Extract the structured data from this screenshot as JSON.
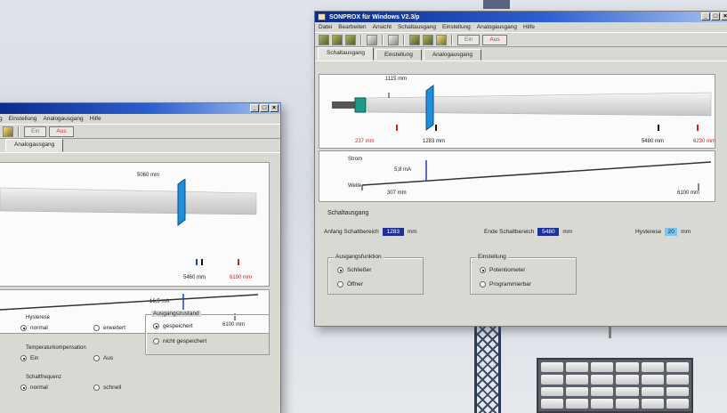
{
  "front_window": {
    "title": "SONPROX für Windows V2.3/p",
    "window_buttons": [
      "_",
      "□",
      "×"
    ],
    "menu": [
      "Datei",
      "Bearbeiten",
      "Ansicht",
      "Schaltausgang",
      "Einstellung",
      "Analogausgang",
      "Hilfe"
    ],
    "toolbar": {
      "on_label": "Ein",
      "off_label": "Aus"
    },
    "tabs": [
      "Schaltausgang",
      "Einstellung",
      "Analogausgang"
    ],
    "active_tab": 0,
    "diagram": {
      "top_label": "1115 mm",
      "bottom_labels": {
        "left_red": "237 mm",
        "blue": "1283 mm",
        "right_black": "5480 mm",
        "right_red": "6230 mm"
      },
      "graph": {
        "y_top": "Strom",
        "y_bottom": "Weite",
        "value": "5,8 mA",
        "x_left": "307 mm",
        "x_right": "6100 mm"
      }
    },
    "schaltausgang": {
      "title": "Schaltausgang",
      "start_label": "Anfang Schaltbereich",
      "start_value": "1283",
      "start_unit": "mm",
      "end_label": "Ende Schaltbereich",
      "end_value": "5480",
      "end_unit": "mm",
      "hyst_label": "Hysterese",
      "hyst_value": "20",
      "hyst_unit": "mm"
    },
    "ausgangsfunktion": {
      "title": "Ausgangsfunktion",
      "options": [
        "Schließer",
        "Öffner"
      ],
      "selected": 0
    },
    "einstellung": {
      "title": "Einstellung",
      "options": [
        "Potentiometer",
        "Programmierbar"
      ],
      "selected": 0
    }
  },
  "back_window": {
    "window_buttons": [
      "_",
      "□",
      "×"
    ],
    "menu": [
      "g",
      "Einstellung",
      "Analogausgang",
      "Hilfe"
    ],
    "toolbar": {
      "on_label": "Ein",
      "off_label": "Aus"
    },
    "tabs": [
      "Analogausgang"
    ],
    "diagram": {
      "top_label": "5060 mm",
      "bottom_labels": {
        "black": "5460 mm",
        "red": "6190 mm"
      },
      "graph": {
        "value": "16,5 mA",
        "x_right": "6100 mm"
      }
    },
    "hysterese": {
      "title": "Hysterese",
      "options": [
        "normal",
        "erweitert"
      ],
      "selected": 0
    },
    "temperatur": {
      "title": "Temperaturkompensation",
      "options": [
        "Ein",
        "Aus"
      ],
      "selected": 0
    },
    "schaltfrequenz": {
      "title": "Schaltfrequenz",
      "options": [
        "normal",
        "schnell"
      ],
      "selected": 0
    },
    "ausgangszustand": {
      "title": "Ausgangszustand",
      "options": [
        "gespeichert",
        "nicht gespeichert"
      ],
      "selected": 0
    }
  }
}
